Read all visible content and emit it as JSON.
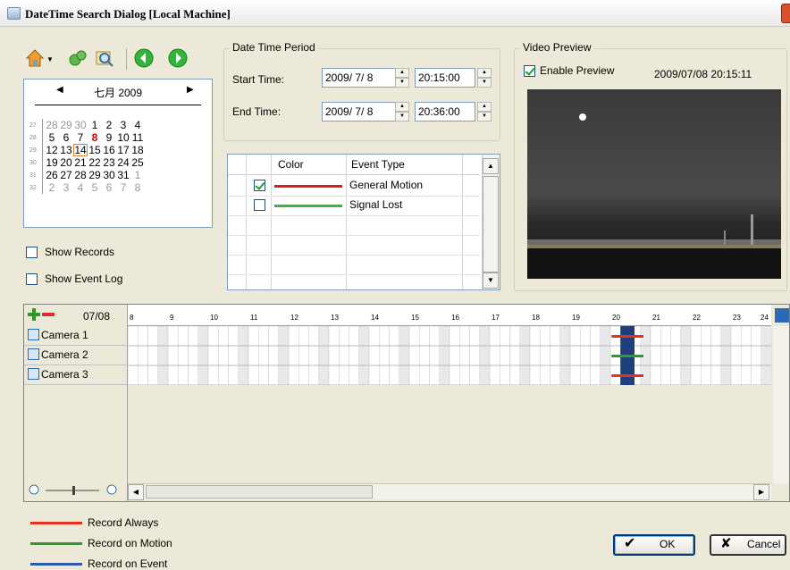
{
  "window": {
    "title": "DateTime Search Dialog  [Local Machine]"
  },
  "calendar": {
    "month_label": "七月 2009",
    "rows": [
      {
        "week": "27",
        "days": [
          "28",
          "29",
          "30",
          "1",
          "2",
          "3",
          "4"
        ]
      },
      {
        "week": "28",
        "days": [
          "5",
          "6",
          "7",
          "8",
          "9",
          "10",
          "11"
        ]
      },
      {
        "week": "29",
        "days": [
          "12",
          "13",
          "14",
          "15",
          "16",
          "17",
          "18"
        ]
      },
      {
        "week": "30",
        "days": [
          "19",
          "20",
          "21",
          "22",
          "23",
          "24",
          "25"
        ]
      },
      {
        "week": "31",
        "days": [
          "26",
          "27",
          "28",
          "29",
          "30",
          "31",
          "1"
        ]
      },
      {
        "week": "32",
        "days": [
          "2",
          "3",
          "4",
          "5",
          "6",
          "7",
          "8"
        ]
      }
    ]
  },
  "options": {
    "show_records_label": "Show Records",
    "show_records_checked": false,
    "show_event_log_label": "Show Event Log",
    "show_event_log_checked": false
  },
  "date_time_period": {
    "title": "Date Time Period",
    "start_label": "Start Time:",
    "start_date": "2009/ 7/ 8",
    "start_time": "20:15:00",
    "end_label": "End Time:",
    "end_date": "2009/ 7/ 8",
    "end_time": "20:36:00"
  },
  "event_table": {
    "col_color": "Color",
    "col_event": "Event Type",
    "rows": [
      {
        "checked": true,
        "color": "#d81e1e",
        "label": "General Motion"
      },
      {
        "checked": false,
        "color": "#3fb33f",
        "label": "Signal Lost"
      }
    ]
  },
  "video_preview": {
    "title": "Video Preview",
    "enable_label": "Enable Preview",
    "enabled": true,
    "timestamp": "2009/07/08 20:15:11"
  },
  "timeline": {
    "date": "07/08",
    "hours": [
      "8",
      "9",
      "10",
      "11",
      "12",
      "13",
      "14",
      "15",
      "16",
      "17",
      "18",
      "19",
      "20",
      "21",
      "22",
      "23",
      "24"
    ],
    "cameras": [
      {
        "label": "Camera 1",
        "mark_color": "#e8301e"
      },
      {
        "label": "Camera 2",
        "mark_color": "#2e9a2e"
      },
      {
        "label": "Camera 3",
        "mark_color": "#e8301e"
      }
    ]
  },
  "legend": [
    {
      "label": "Record Always",
      "color": "#e8301e"
    },
    {
      "label": "Record on Motion",
      "color": "#2e9a2e"
    },
    {
      "label": "Record on Event",
      "color": "#2f5aa8"
    }
  ],
  "buttons": {
    "ok_label": "OK",
    "cancel_label": "Cancel"
  }
}
